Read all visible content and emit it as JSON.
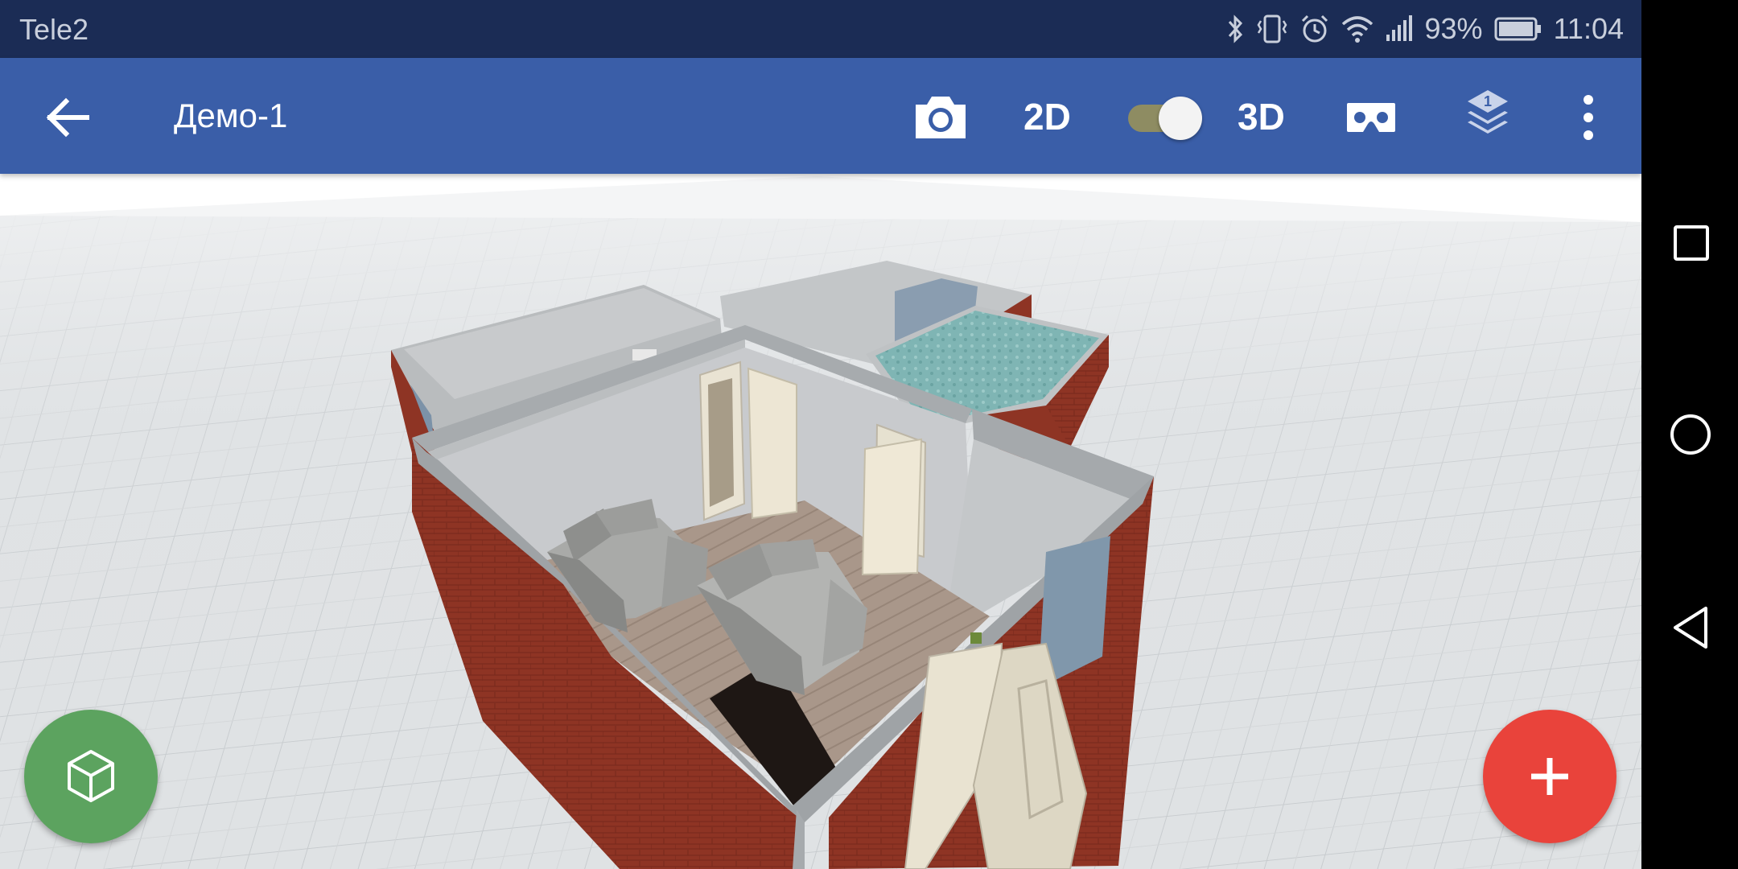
{
  "status_bar": {
    "carrier": "Tele2",
    "battery_percent": "93%",
    "time": "11:04",
    "icons": [
      "bluetooth-icon",
      "vibrate-icon",
      "alarm-icon",
      "wifi-icon",
      "signal-icon",
      "battery-icon"
    ]
  },
  "app_bar": {
    "title": "Демо-1",
    "mode_2d_label": "2D",
    "mode_3d_label": "3D",
    "mode_switch_on": true,
    "layer_number": "1",
    "icons": [
      "back-arrow-icon",
      "camera-icon",
      "vr-headset-icon",
      "layers-icon",
      "more-vert-icon"
    ]
  },
  "fabs": {
    "left_icon": "cube-icon",
    "right_icon": "plus-icon"
  },
  "nav_bar": {
    "icons": [
      "recents-square-icon",
      "home-circle-icon",
      "back-triangle-icon"
    ]
  },
  "colors": {
    "status_bar": "#1b2c55",
    "app_bar": "#3a5ea8",
    "fab_left": "#5ca35f",
    "fab_right": "#e9433b",
    "brick": "#8e3424"
  }
}
